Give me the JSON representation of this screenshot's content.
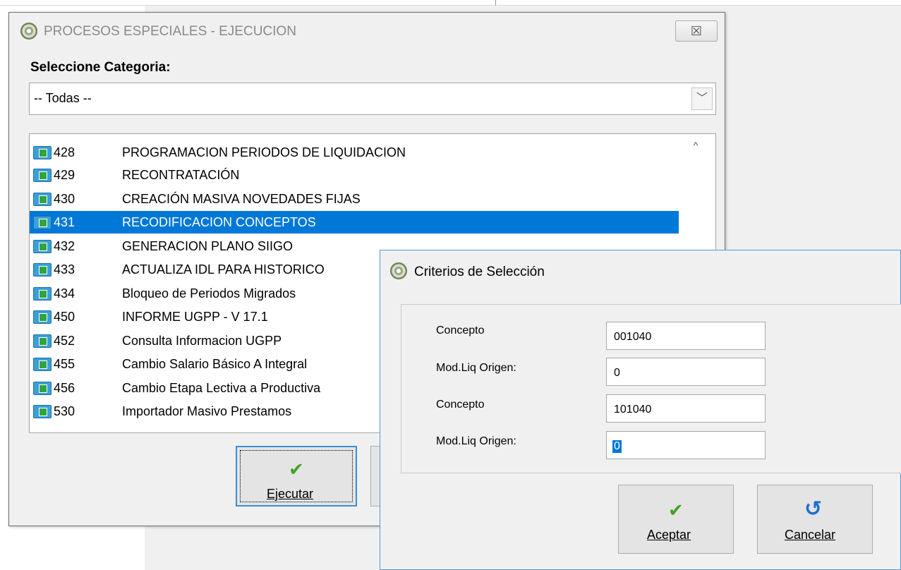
{
  "main_window": {
    "title": "PROCESOS ESPECIALES - EJECUCION",
    "close_label": "☒",
    "category_label": "Seleccione Categoria:",
    "category_value": "-- Todas --",
    "combo_arrow": "﹀",
    "items": [
      {
        "code": "428",
        "desc": "PROGRAMACION PERIODOS DE LIQUIDACION"
      },
      {
        "code": "429",
        "desc": "RECONTRATACIÓN"
      },
      {
        "code": "430",
        "desc": "CREACIÓN MASIVA NOVEDADES FIJAS"
      },
      {
        "code": "431",
        "desc": "RECODIFICACION CONCEPTOS",
        "selected": true
      },
      {
        "code": "432",
        "desc": "GENERACION PLANO SIIGO"
      },
      {
        "code": "433",
        "desc": "ACTUALIZA IDL PARA HISTORICO"
      },
      {
        "code": "434",
        "desc": "Bloqueo de Periodos Migrados"
      },
      {
        "code": "450",
        "desc": "INFORME UGPP - V 17.1"
      },
      {
        "code": "452",
        "desc": "Consulta Informacion UGPP"
      },
      {
        "code": "455",
        "desc": "Cambio Salario Básico A Integral"
      },
      {
        "code": "456",
        "desc": "Cambio Etapa Lectiva a Productiva"
      },
      {
        "code": "530",
        "desc": "Importador Masivo Prestamos"
      }
    ],
    "scroll_up": "^",
    "execute_label": "Ejecutar",
    "execute_icon": "✔"
  },
  "dialog": {
    "title": "Criterios de Selección",
    "fields": [
      {
        "label": "Concepto",
        "value": "001040"
      },
      {
        "label": "Mod.Liq Origen:",
        "value": "0"
      },
      {
        "label": "Concepto",
        "value": "101040"
      },
      {
        "label": "Mod.Liq Origen:",
        "value": "0"
      }
    ],
    "accept_label": "Aceptar",
    "accept_icon": "✔",
    "cancel_label": "Cancelar",
    "cancel_icon": "↺"
  }
}
